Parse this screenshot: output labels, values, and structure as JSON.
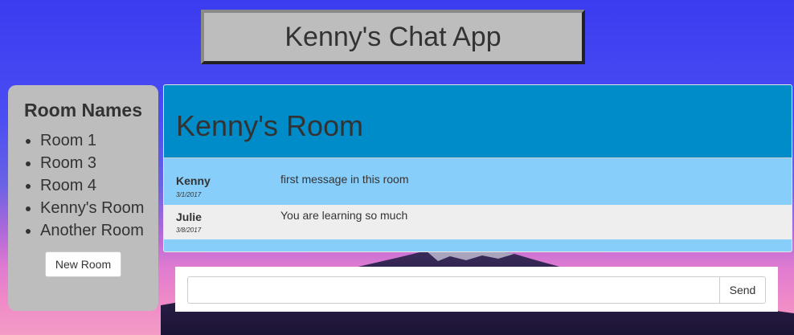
{
  "app": {
    "title": "Kenny's Chat App"
  },
  "sidebar": {
    "heading": "Room Names",
    "rooms": [
      {
        "label": "Room 1"
      },
      {
        "label": "Room 3"
      },
      {
        "label": "Room 4"
      },
      {
        "label": "Kenny's Room"
      },
      {
        "label": "Another Room"
      }
    ],
    "new_room_label": "New Room"
  },
  "room": {
    "title": "Kenny's Room",
    "messages": [
      {
        "user": "Kenny",
        "date": "3/1/2017",
        "text": "first message in this room"
      },
      {
        "user": "Julie",
        "date": "3/8/2017",
        "text": "You are learning so much"
      }
    ]
  },
  "composer": {
    "input_value": "",
    "input_placeholder": "",
    "send_label": "Send"
  },
  "colors": {
    "header_blue": "#008cc8",
    "message_light_blue": "#87cefa",
    "alt_row_gray": "#eeeeee",
    "panel_gray": "#bdbdbd"
  }
}
